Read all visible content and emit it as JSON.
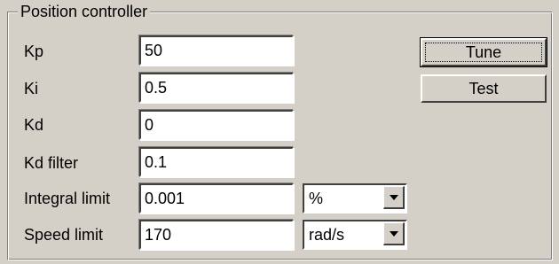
{
  "group": {
    "title": "Position controller"
  },
  "rows": [
    {
      "label": "Kp",
      "value": "50"
    },
    {
      "label": "Ki",
      "value": "0.5"
    },
    {
      "label": "Kd",
      "value": "0"
    },
    {
      "label": "Kd filter",
      "value": "0.1"
    },
    {
      "label": "Integral limit",
      "value": "0.001",
      "unit": "%"
    },
    {
      "label": "Speed limit",
      "value": "170",
      "unit": "rad/s"
    }
  ],
  "buttons": {
    "tune": "Tune",
    "test": "Test"
  },
  "icons": {
    "dropdown_arrow": "triangle-down-icon"
  }
}
